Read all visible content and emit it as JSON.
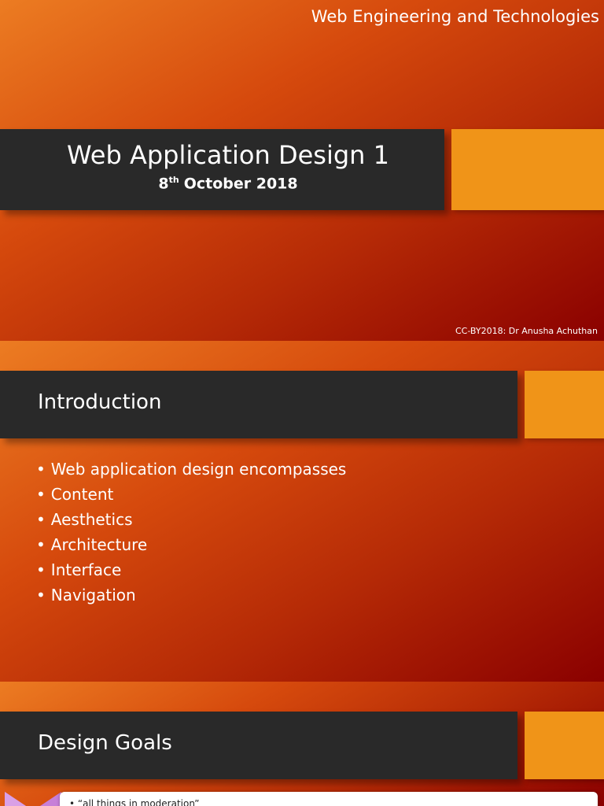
{
  "slide1": {
    "topic": "Web Engineering and Technologies",
    "title": "Web Application Design 1",
    "date_day": "8",
    "date_suffix": "th",
    "date_rest": "October 2018",
    "credit": "CC-BY2018: Dr Anusha Achuthan"
  },
  "slide2": {
    "heading": "Introduction",
    "bullets": [
      "Web application design encompasses",
      "Content",
      "Aesthetics",
      "Architecture",
      "Interface",
      "Navigation"
    ]
  },
  "slide3": {
    "heading": "Design Goals",
    "card_text": "• “all things in moderation”"
  },
  "colors": {
    "title_bar": "#292929",
    "accent": "#f09418",
    "gradient_light": "#ec7c22",
    "gradient_dark": "#8a0000"
  }
}
